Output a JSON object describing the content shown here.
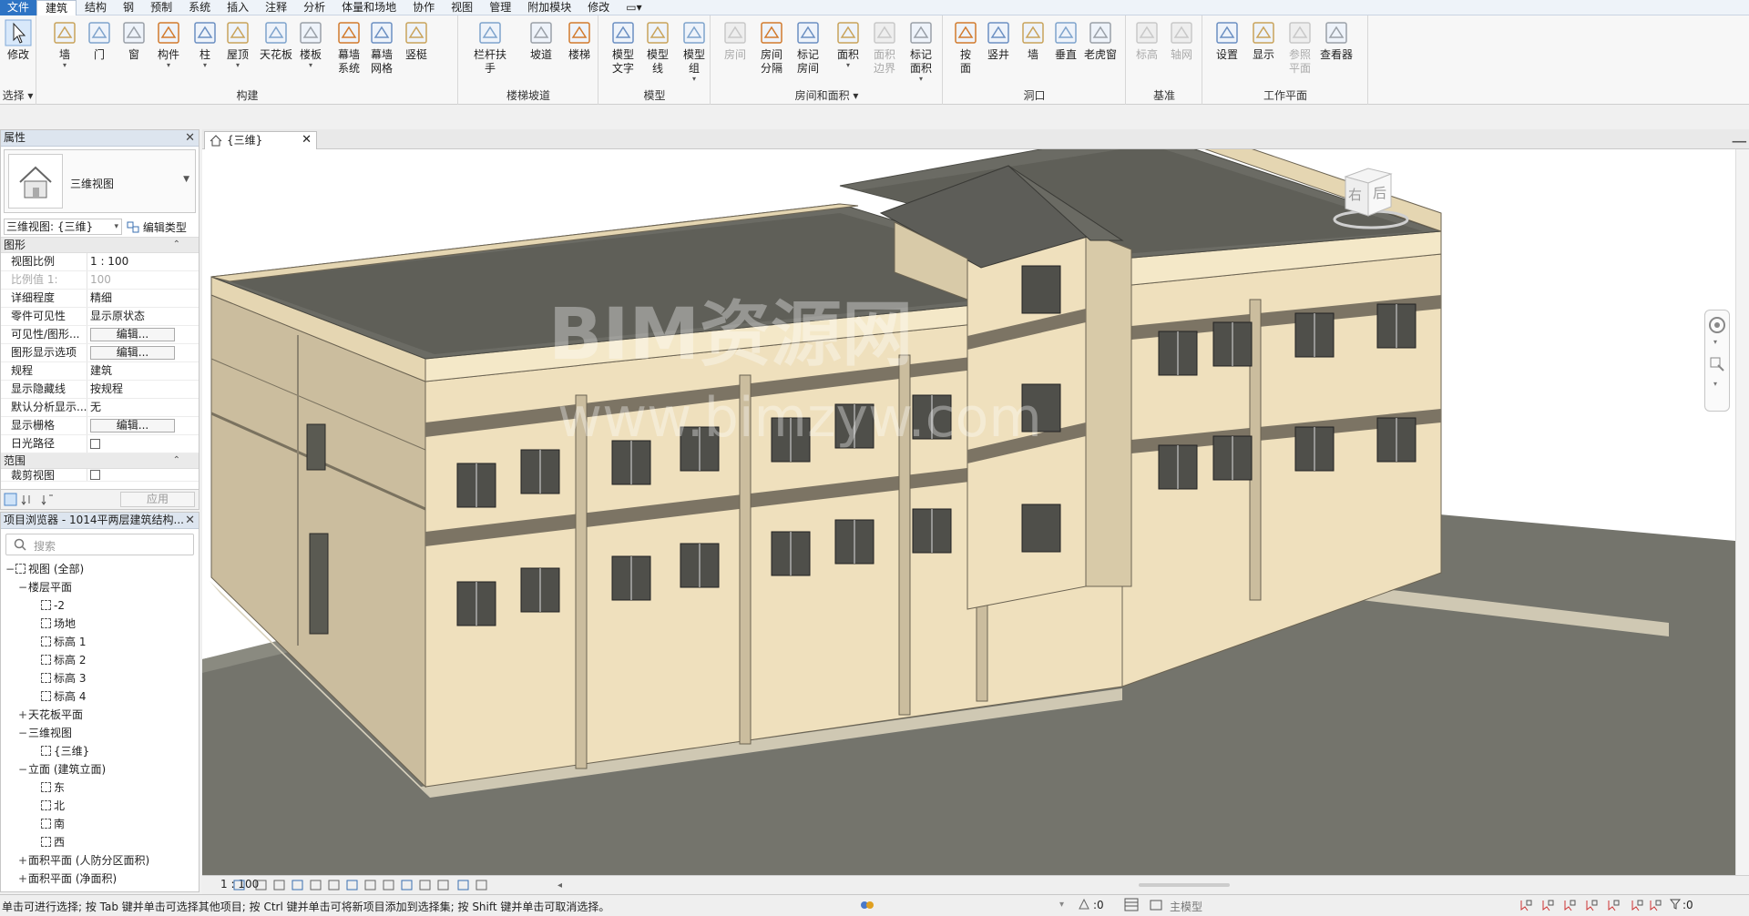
{
  "menu": {
    "tabs": [
      "文件",
      "建筑",
      "结构",
      "钢",
      "预制",
      "系统",
      "插入",
      "注释",
      "分析",
      "体量和场地",
      "协作",
      "视图",
      "管理",
      "附加模块",
      "修改"
    ],
    "active_index": 1
  },
  "ribbon": {
    "select_label": "选择",
    "modify": "修改",
    "build_title": "构建",
    "build_tools": [
      "墙",
      "门",
      "窗",
      "构件",
      "柱",
      "屋顶",
      "天花板",
      "楼板",
      "幕墙\n系统",
      "幕墙\n网格",
      "竖梃"
    ],
    "stair_title": "楼梯坡道",
    "stair_tools": [
      "栏杆扶手",
      "坡道",
      "楼梯"
    ],
    "model_title": "模型",
    "model_tools": [
      "模型\n文字",
      "模型\n线",
      "模型\n组"
    ],
    "room_title": "房间和面积",
    "room_tools": [
      "房间",
      "房间\n分隔",
      "标记\n房间",
      "面积",
      "面积\n边界",
      "标记\n面积"
    ],
    "opening_title": "洞口",
    "opening_tools": [
      "按\n面",
      "竖井",
      "墙",
      "垂直",
      "老虎窗"
    ],
    "datum_title": "基准",
    "datum_tools": [
      "标高",
      "轴网"
    ],
    "workplane_title": "工作平面",
    "workplane_tools": [
      "设置",
      "显示",
      "参照\n平面",
      "查看器"
    ]
  },
  "properties": {
    "title": "属性",
    "type_name": "三维视图",
    "view_selector": "三维视图: {三维}",
    "edit_type": "编辑类型",
    "section_graphics": "图形",
    "rows": [
      {
        "k": "视图比例",
        "v": "1 : 100"
      },
      {
        "k": "比例值 1:",
        "v": "100"
      },
      {
        "k": "详细程度",
        "v": "精细"
      },
      {
        "k": "零件可见性",
        "v": "显示原状态"
      },
      {
        "k": "可见性/图形...",
        "v": "编辑..."
      },
      {
        "k": "图形显示选项",
        "v": "编辑..."
      },
      {
        "k": "规程",
        "v": "建筑"
      },
      {
        "k": "显示隐藏线",
        "v": "按规程"
      },
      {
        "k": "默认分析显示...",
        "v": "无"
      },
      {
        "k": "显示栅格",
        "v": "编辑..."
      },
      {
        "k": "日光路径",
        "v": ""
      }
    ],
    "section_extent": "范围",
    "cropped_row": "裁剪视图",
    "apply": "应用"
  },
  "browser": {
    "title": "项目浏览器 - 1014平两层建筑结构...",
    "search_placeholder": "搜索",
    "nodes": [
      {
        "t": "视图 (全部)",
        "lvl": 0,
        "tg": "−",
        "icon": true
      },
      {
        "t": "楼层平面",
        "lvl": 1,
        "tg": "−",
        "icon": false
      },
      {
        "t": "-2",
        "lvl": 2,
        "tg": "",
        "icon": true
      },
      {
        "t": "场地",
        "lvl": 2,
        "tg": "",
        "icon": true
      },
      {
        "t": "标高 1",
        "lvl": 2,
        "tg": "",
        "icon": true
      },
      {
        "t": "标高 2",
        "lvl": 2,
        "tg": "",
        "icon": true
      },
      {
        "t": "标高 3",
        "lvl": 2,
        "tg": "",
        "icon": true
      },
      {
        "t": "标高 4",
        "lvl": 2,
        "tg": "",
        "icon": true
      },
      {
        "t": "天花板平面",
        "lvl": 1,
        "tg": "+",
        "icon": false
      },
      {
        "t": "三维视图",
        "lvl": 1,
        "tg": "−",
        "icon": false
      },
      {
        "t": "{三维}",
        "lvl": 2,
        "tg": "",
        "icon": true
      },
      {
        "t": "立面 (建筑立面)",
        "lvl": 1,
        "tg": "−",
        "icon": false
      },
      {
        "t": "东",
        "lvl": 2,
        "tg": "",
        "icon": true
      },
      {
        "t": "北",
        "lvl": 2,
        "tg": "",
        "icon": true
      },
      {
        "t": "南",
        "lvl": 2,
        "tg": "",
        "icon": true
      },
      {
        "t": "西",
        "lvl": 2,
        "tg": "",
        "icon": true
      },
      {
        "t": "面积平面 (人防分区面积)",
        "lvl": 1,
        "tg": "+",
        "icon": false
      },
      {
        "t": "面积平面 (净面积)",
        "lvl": 1,
        "tg": "+",
        "icon": false
      }
    ]
  },
  "view": {
    "tab_title": "{三维}",
    "viewcube_right": "右",
    "viewcube_back": "后",
    "watermark1": "BIM资源网",
    "watermark2": "www.bimzyw.com",
    "scale": "1 : 100"
  },
  "status": {
    "message": "单击可进行选择; 按 Tab 键并单击可选择其他项目; 按 Ctrl 键并单击可将新项目添加到选择集; 按 Shift 键并单击可取消选择。",
    "zero1": ":0",
    "model": "主模型",
    "filter_count": ":0"
  },
  "colors": {
    "wall": "#efe0bd",
    "wall_shade": "#c8b99a",
    "roof": "#6b6b64",
    "ground": "#74746c",
    "accent": "#2e74c4"
  }
}
